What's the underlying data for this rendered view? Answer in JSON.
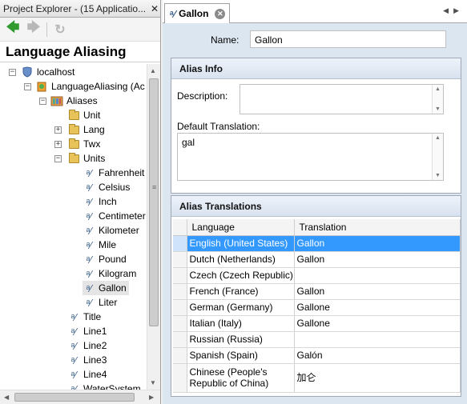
{
  "project_explorer": {
    "title": "Project Explorer - (15 Applicatio...",
    "close_label": "✕",
    "heading": "Language Aliasing",
    "tree": [
      {
        "label": "localhost",
        "icon": "server-icon"
      },
      {
        "label": "LanguageAliasing (Ac",
        "icon": "application-icon"
      },
      {
        "label": "Aliases",
        "icon": "aliases-icon"
      },
      {
        "label": "Unit",
        "icon": "folder-icon"
      },
      {
        "label": "Lang",
        "icon": "folder-icon"
      },
      {
        "label": "Twx",
        "icon": "folder-icon"
      },
      {
        "label": "Units",
        "icon": "folder-icon"
      },
      {
        "label": "Fahrenheit",
        "icon": "alias-icon"
      },
      {
        "label": "Celsius",
        "icon": "alias-icon"
      },
      {
        "label": "Inch",
        "icon": "alias-icon"
      },
      {
        "label": "Centimeter",
        "icon": "alias-icon"
      },
      {
        "label": "Kilometer",
        "icon": "alias-icon"
      },
      {
        "label": "Mile",
        "icon": "alias-icon"
      },
      {
        "label": "Pound",
        "icon": "alias-icon"
      },
      {
        "label": "Kilogram",
        "icon": "alias-icon"
      },
      {
        "label": "Gallon",
        "icon": "alias-icon"
      },
      {
        "label": "Liter",
        "icon": "alias-icon"
      },
      {
        "label": "Title",
        "icon": "alias-icon"
      },
      {
        "label": "Line1",
        "icon": "alias-icon"
      },
      {
        "label": "Line2",
        "icon": "alias-icon"
      },
      {
        "label": "Line3",
        "icon": "alias-icon"
      },
      {
        "label": "Line4",
        "icon": "alias-icon"
      },
      {
        "label": "WaterSystem",
        "icon": "alias-icon"
      }
    ]
  },
  "editor": {
    "tab_label": "Gallon",
    "name_label": "Name:",
    "name_value": "Gallon",
    "alias_info": {
      "title": "Alias Info",
      "description_label": "Description:",
      "description_value": "",
      "default_translation_label": "Default Translation:",
      "default_translation_value": "gal"
    },
    "alias_translations": {
      "title": "Alias Translations",
      "columns": [
        "Language",
        "Translation"
      ],
      "rows": [
        {
          "language": "English (United States)",
          "translation": "Gallon"
        },
        {
          "language": "Dutch (Netherlands)",
          "translation": "Gallon"
        },
        {
          "language": "Czech (Czech Republic)",
          "translation": ""
        },
        {
          "language": "French (France)",
          "translation": "Gallon"
        },
        {
          "language": "German (Germany)",
          "translation": "Gallone"
        },
        {
          "language": "Italian (Italy)",
          "translation": "Gallone"
        },
        {
          "language": "Russian (Russia)",
          "translation": ""
        },
        {
          "language": "Spanish (Spain)",
          "translation": "Galón"
        },
        {
          "language": "Chinese (People's Republic of China)",
          "translation": "加仑"
        }
      ],
      "selected_row": 0
    }
  },
  "colors": {
    "selection": "#3399ff",
    "editor_background": "#dce6f1",
    "back_arrow": "#2f9a2f"
  }
}
